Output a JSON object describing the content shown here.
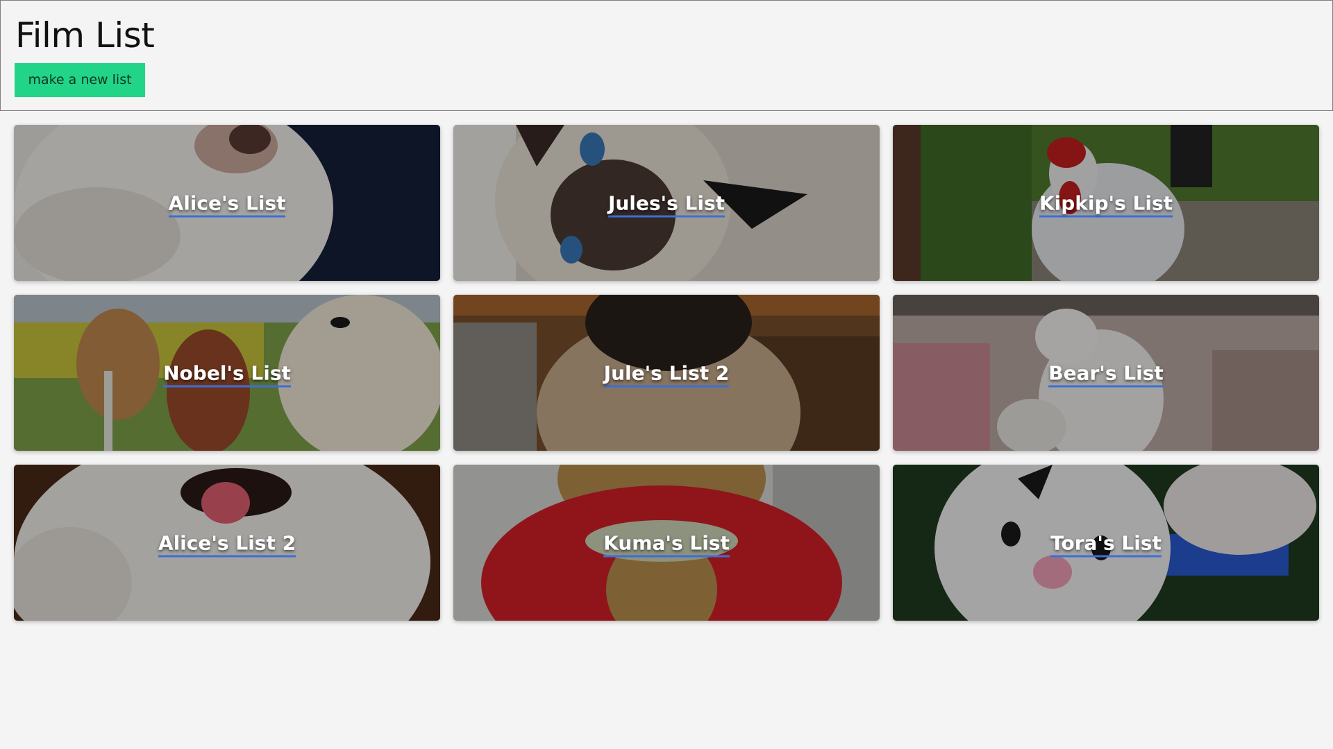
{
  "header": {
    "title": "Film List",
    "new_list_label": "make a new list"
  },
  "lists": [
    {
      "title": "Alice's List",
      "photo": "fluffy-dog-closeup"
    },
    {
      "title": "Jules's List",
      "photo": "siamese-cat"
    },
    {
      "title": "Kipkip's List",
      "photo": "white-chicken-garden"
    },
    {
      "title": "Nobel's List",
      "photo": "horses-and-pomeranian"
    },
    {
      "title": "Jule's List 2",
      "photo": "siamese-cat-closeup"
    },
    {
      "title": "Bear's List",
      "photo": "polar-bear-plush-store"
    },
    {
      "title": "Alice's List 2",
      "photo": "fluffy-dog-tongue"
    },
    {
      "title": "Kuma's List",
      "photo": "bear-plush-red-cape"
    },
    {
      "title": "Tora's List",
      "photo": "tiger-plush"
    }
  ],
  "colors": {
    "button": "#21d487",
    "link_underline": "#3b6fd6",
    "background": "#f4f4f4"
  }
}
